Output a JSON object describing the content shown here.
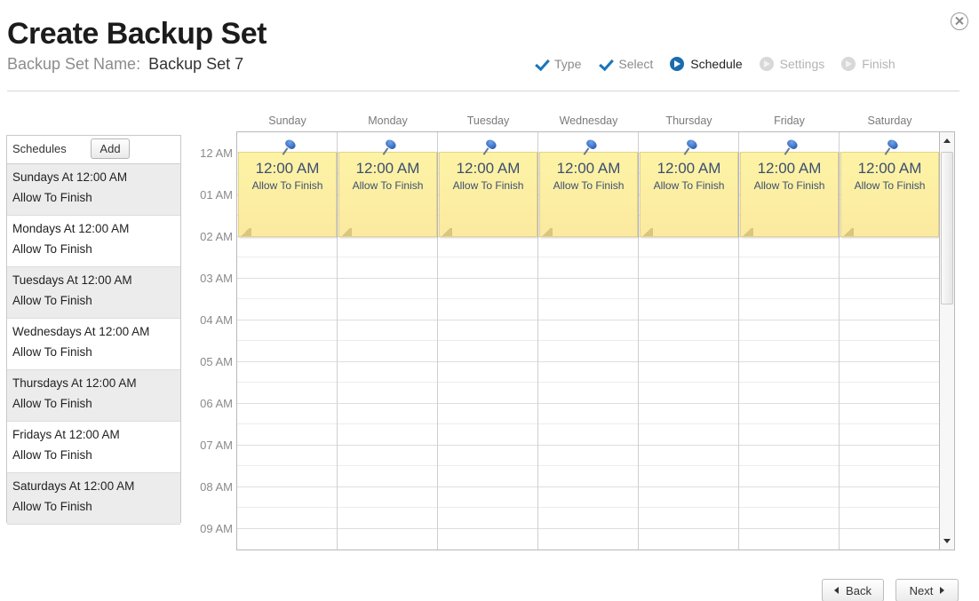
{
  "header": {
    "title": "Create Backup Set",
    "name_label": "Backup Set Name:",
    "name_value": "Backup Set 7"
  },
  "steps": [
    {
      "label": "Type",
      "state": "done"
    },
    {
      "label": "Select",
      "state": "done"
    },
    {
      "label": "Schedule",
      "state": "current"
    },
    {
      "label": "Settings",
      "state": "future"
    },
    {
      "label": "Finish",
      "state": "future"
    }
  ],
  "schedules": {
    "title": "Schedules",
    "add_label": "Add",
    "items": [
      {
        "line1": "Sundays At  12:00 AM",
        "line2": "Allow To Finish"
      },
      {
        "line1": "Mondays At  12:00 AM",
        "line2": "Allow To Finish"
      },
      {
        "line1": "Tuesdays At  12:00 AM",
        "line2": "Allow To Finish"
      },
      {
        "line1": "Wednesdays At  12:00 AM",
        "line2": "Allow To Finish"
      },
      {
        "line1": "Thursdays At  12:00 AM",
        "line2": "Allow To Finish"
      },
      {
        "line1": "Fridays At  12:00 AM",
        "line2": "Allow To Finish"
      },
      {
        "line1": "Saturdays At  12:00 AM",
        "line2": "Allow To Finish"
      }
    ]
  },
  "calendar": {
    "days": [
      "Sunday",
      "Monday",
      "Tuesday",
      "Wednesday",
      "Thursday",
      "Friday",
      "Saturday"
    ],
    "times": [
      "12 AM",
      "01 AM",
      "02 AM",
      "03 AM",
      "04 AM",
      "05 AM",
      "06 AM",
      "07 AM",
      "08 AM",
      "09 AM"
    ],
    "events": [
      {
        "time": "12:00 AM",
        "label": "Allow To Finish"
      },
      {
        "time": "12:00 AM",
        "label": "Allow To Finish"
      },
      {
        "time": "12:00 AM",
        "label": "Allow To Finish"
      },
      {
        "time": "12:00 AM",
        "label": "Allow To Finish"
      },
      {
        "time": "12:00 AM",
        "label": "Allow To Finish"
      },
      {
        "time": "12:00 AM",
        "label": "Allow To Finish"
      },
      {
        "time": "12:00 AM",
        "label": "Allow To Finish"
      }
    ]
  },
  "footer": {
    "back_label": "Back",
    "next_label": "Next"
  },
  "colors": {
    "accent": "#1b75bb",
    "note_fill": "#fdf3a5",
    "note_text": "#3c4f70"
  }
}
